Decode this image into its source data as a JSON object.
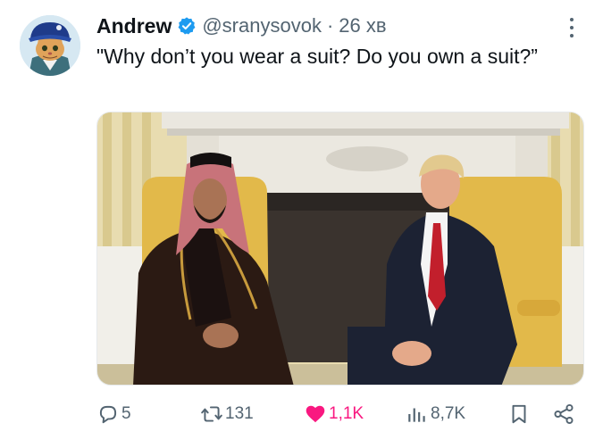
{
  "tweet": {
    "author_name": "Andrew",
    "handle": "@sranysovok",
    "separator": "·",
    "time": "26 хв",
    "text": "\"Why don’t you wear a suit? Do you own a suit?”",
    "image_description": "Two men seated in yellow armchairs in front of a white marble fireplace"
  },
  "actions": {
    "replies": "5",
    "reposts": "131",
    "likes": "1,1K",
    "views": "8,7K"
  },
  "colors": {
    "verified": "#1d9bf0",
    "like": "#f91880",
    "secondary_text": "#536471",
    "primary_text": "#0f1419"
  },
  "icons": {
    "avatar": "cat-in-hat-avatar",
    "verified": "verified-badge-icon",
    "more": "more-options-icon",
    "reply": "reply-icon",
    "repost": "repost-icon",
    "like": "heart-icon",
    "views": "views-icon",
    "bookmark": "bookmark-icon",
    "share": "share-icon"
  }
}
